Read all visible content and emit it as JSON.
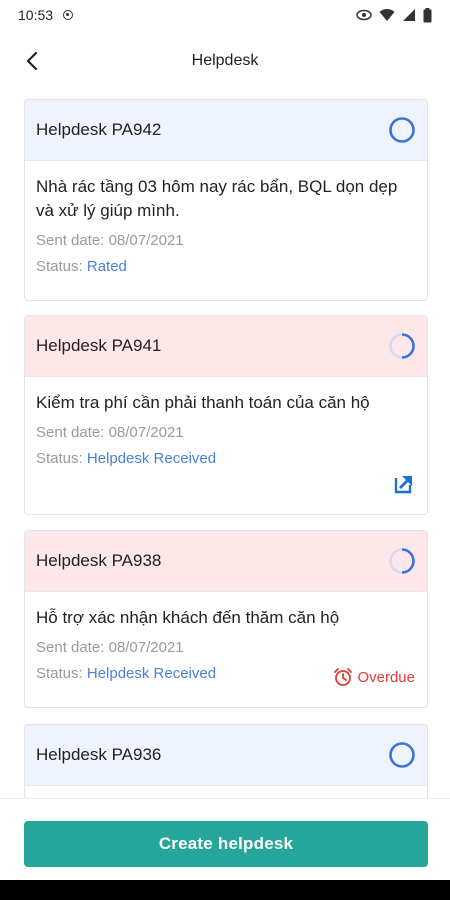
{
  "status_bar": {
    "time": "10:53"
  },
  "header": {
    "title": "Helpdesk"
  },
  "labels": {
    "sent_date": "Sent date: ",
    "status": "Status: "
  },
  "tickets": [
    {
      "code": "Helpdesk PA942",
      "content": "Nhà rác tầng 03 hôm nay rác bẩn, BQL dọn dẹp và xử lý giúp mình.",
      "sent_date": "08/07/2021",
      "status": "Rated",
      "progress_icon": "empty-circle-icon"
    },
    {
      "code": "Helpdesk PA941",
      "content": "Kiểm tra phí cần phải thanh toán của căn hộ",
      "sent_date": "08/07/2021",
      "status": "Helpdesk Received",
      "progress_icon": "partial-circle-icon",
      "action_icon": "open-external-icon"
    },
    {
      "code": "Helpdesk PA938",
      "content": "Hỗ trợ xác nhận khách đến thăm căn hộ",
      "sent_date": "08/07/2021",
      "status": "Helpdesk Received",
      "progress_icon": "partial-circle-icon",
      "badge": "Overdue"
    },
    {
      "code": "Helpdesk PA936",
      "progress_icon": "empty-circle-icon"
    }
  ],
  "footer": {
    "create_label": "Create helpdesk"
  },
  "colors": {
    "accent": "#26a69a",
    "link": "#4a7fe0",
    "overdue": "#e53935",
    "head_blue": "#eef3fd",
    "head_pink": "#fde7e8"
  }
}
